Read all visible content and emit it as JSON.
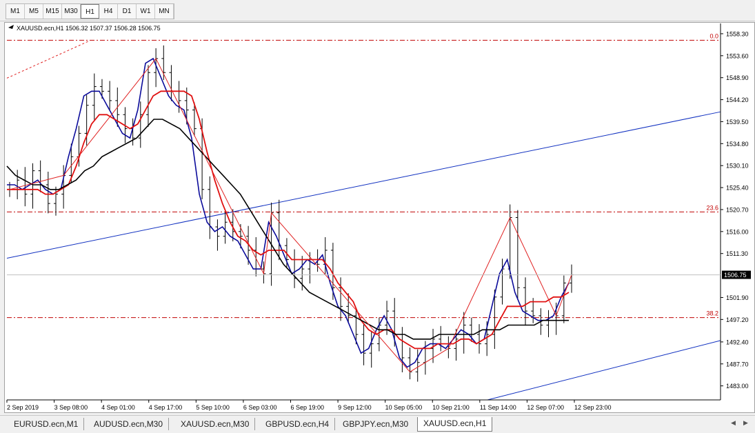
{
  "toolbar": {
    "timeframes": [
      "M1",
      "M5",
      "M15",
      "M30",
      "H1",
      "H4",
      "D1",
      "W1",
      "MN"
    ],
    "active": "H1"
  },
  "chart_data": {
    "type": "line",
    "title": "XAUUSD.ecn,H1  1506.32 1507.37 1506.28 1506.75",
    "ylim": [
      1480.0,
      1560.5
    ],
    "x_ticks": [
      "2 Sep 2019",
      "3 Sep 08:00",
      "4 Sep 01:00",
      "4 Sep 17:00",
      "5 Sep 10:00",
      "6 Sep 03:00",
      "6 Sep 19:00",
      "9 Sep 12:00",
      "10 Sep 05:00",
      "10 Sep 21:00",
      "11 Sep 14:00",
      "12 Sep 07:00",
      "12 Sep 23:00"
    ],
    "y_ticks": [
      1558.3,
      1553.6,
      1548.9,
      1544.2,
      1539.5,
      1534.8,
      1530.1,
      1525.4,
      1520.7,
      1516.0,
      1511.3,
      1506.75,
      1501.9,
      1497.2,
      1492.4,
      1487.7,
      1483.0
    ],
    "current_price": 1506.75,
    "fibonacci": [
      {
        "label": "0.0",
        "price": 1556.9
      },
      {
        "label": "23.6",
        "price": 1520.2
      },
      {
        "label": "38.2",
        "price": 1497.6
      }
    ],
    "price_close": [
      1525,
      1527,
      1524,
      1529,
      1526,
      1522,
      1524,
      1528,
      1532,
      1537,
      1543,
      1547,
      1546,
      1544,
      1541,
      1538,
      1536,
      1541,
      1550,
      1553,
      1550,
      1546,
      1544,
      1542,
      1538,
      1525,
      1517,
      1515,
      1518,
      1516,
      1515,
      1512,
      1508,
      1507,
      1520,
      1513,
      1510,
      1506,
      1508,
      1510,
      1509,
      1512,
      1504,
      1500,
      1498,
      1494,
      1490,
      1492,
      1496,
      1499,
      1494,
      1489,
      1486,
      1488,
      1491,
      1493,
      1492,
      1491,
      1493,
      1496,
      1494,
      1492,
      1494,
      1502,
      1508,
      1519,
      1504,
      1499,
      1498,
      1496,
      1497,
      1498,
      1505,
      1506.75
    ],
    "price_colors": {
      "bars": "#000000",
      "ma_fast": "#0a0a9a",
      "ma_mid": "#e01010",
      "ma_slow": "#000000",
      "zigzag": "#e02020",
      "channel": "#1030c0",
      "fib": "#c00000"
    },
    "series": [
      {
        "values": [
          1526,
          1526,
          1525,
          1526,
          1527,
          1525,
          1524,
          1525,
          1532,
          1538,
          1545,
          1546,
          1546,
          1543,
          1540,
          1537,
          1536,
          1542,
          1552,
          1553,
          1549,
          1545,
          1543,
          1542,
          1536,
          1524,
          1518,
          1516,
          1517,
          1515,
          1514,
          1511,
          1508,
          1508,
          1518,
          1515,
          1511,
          1507,
          1508,
          1510,
          1509,
          1511,
          1505,
          1500,
          1498,
          1494,
          1490,
          1491,
          1495,
          1498,
          1495,
          1489,
          1487,
          1488,
          1491,
          1492,
          1492,
          1491,
          1493,
          1495,
          1494,
          1492,
          1493,
          1500,
          1507,
          1510,
          1503,
          1499,
          1498,
          1497,
          1497,
          1498,
          1502,
          1505
        ]
      },
      {
        "values": [
          1525,
          1525,
          1525,
          1525,
          1525,
          1524,
          1524,
          1525,
          1526,
          1530,
          1535,
          1539,
          1541,
          1541,
          1540,
          1539,
          1538,
          1539,
          1542,
          1545,
          1546,
          1546,
          1546,
          1546,
          1545,
          1540,
          1533,
          1527,
          1522,
          1518,
          1515,
          1514,
          1512,
          1511,
          1512,
          1512,
          1512,
          1510,
          1510,
          1510,
          1510,
          1510,
          1508,
          1505,
          1503,
          1501,
          1497,
          1495,
          1494,
          1495,
          1495,
          1493,
          1492,
          1491,
          1491,
          1491,
          1492,
          1492,
          1492,
          1493,
          1493,
          1492,
          1493,
          1494,
          1497,
          1500,
          1500,
          1500,
          1501,
          1501,
          1501,
          1502,
          1502,
          1503
        ]
      },
      {
        "values": [
          1530,
          1528,
          1527,
          1526,
          1526,
          1525,
          1525,
          1526,
          1527,
          1529,
          1530,
          1532,
          1533,
          1534,
          1535,
          1536,
          1538,
          1540,
          1540,
          1539,
          1538,
          1536,
          1534,
          1532,
          1530,
          1528,
          1526,
          1524,
          1521,
          1518,
          1515,
          1512,
          1509,
          1507,
          1505,
          1503,
          1502,
          1501,
          1500,
          1499,
          1498,
          1497,
          1496,
          1495,
          1495,
          1494,
          1494,
          1493,
          1493,
          1493,
          1494,
          1494,
          1494,
          1494,
          1494,
          1495,
          1495,
          1495,
          1496,
          1496,
          1496,
          1496,
          1497,
          1497,
          1497,
          1497
        ]
      }
    ]
  },
  "tabs": [
    "EURUSD.ecn,M1",
    "AUDUSD.ecn,M30",
    "XAUUSD.ecn,M30",
    "GBPUSD.ecn,H4",
    "GBPJPY.ecn,M30",
    "XAUUSD.ecn,H1"
  ],
  "active_tab": "XAUUSD.ecn,H1"
}
